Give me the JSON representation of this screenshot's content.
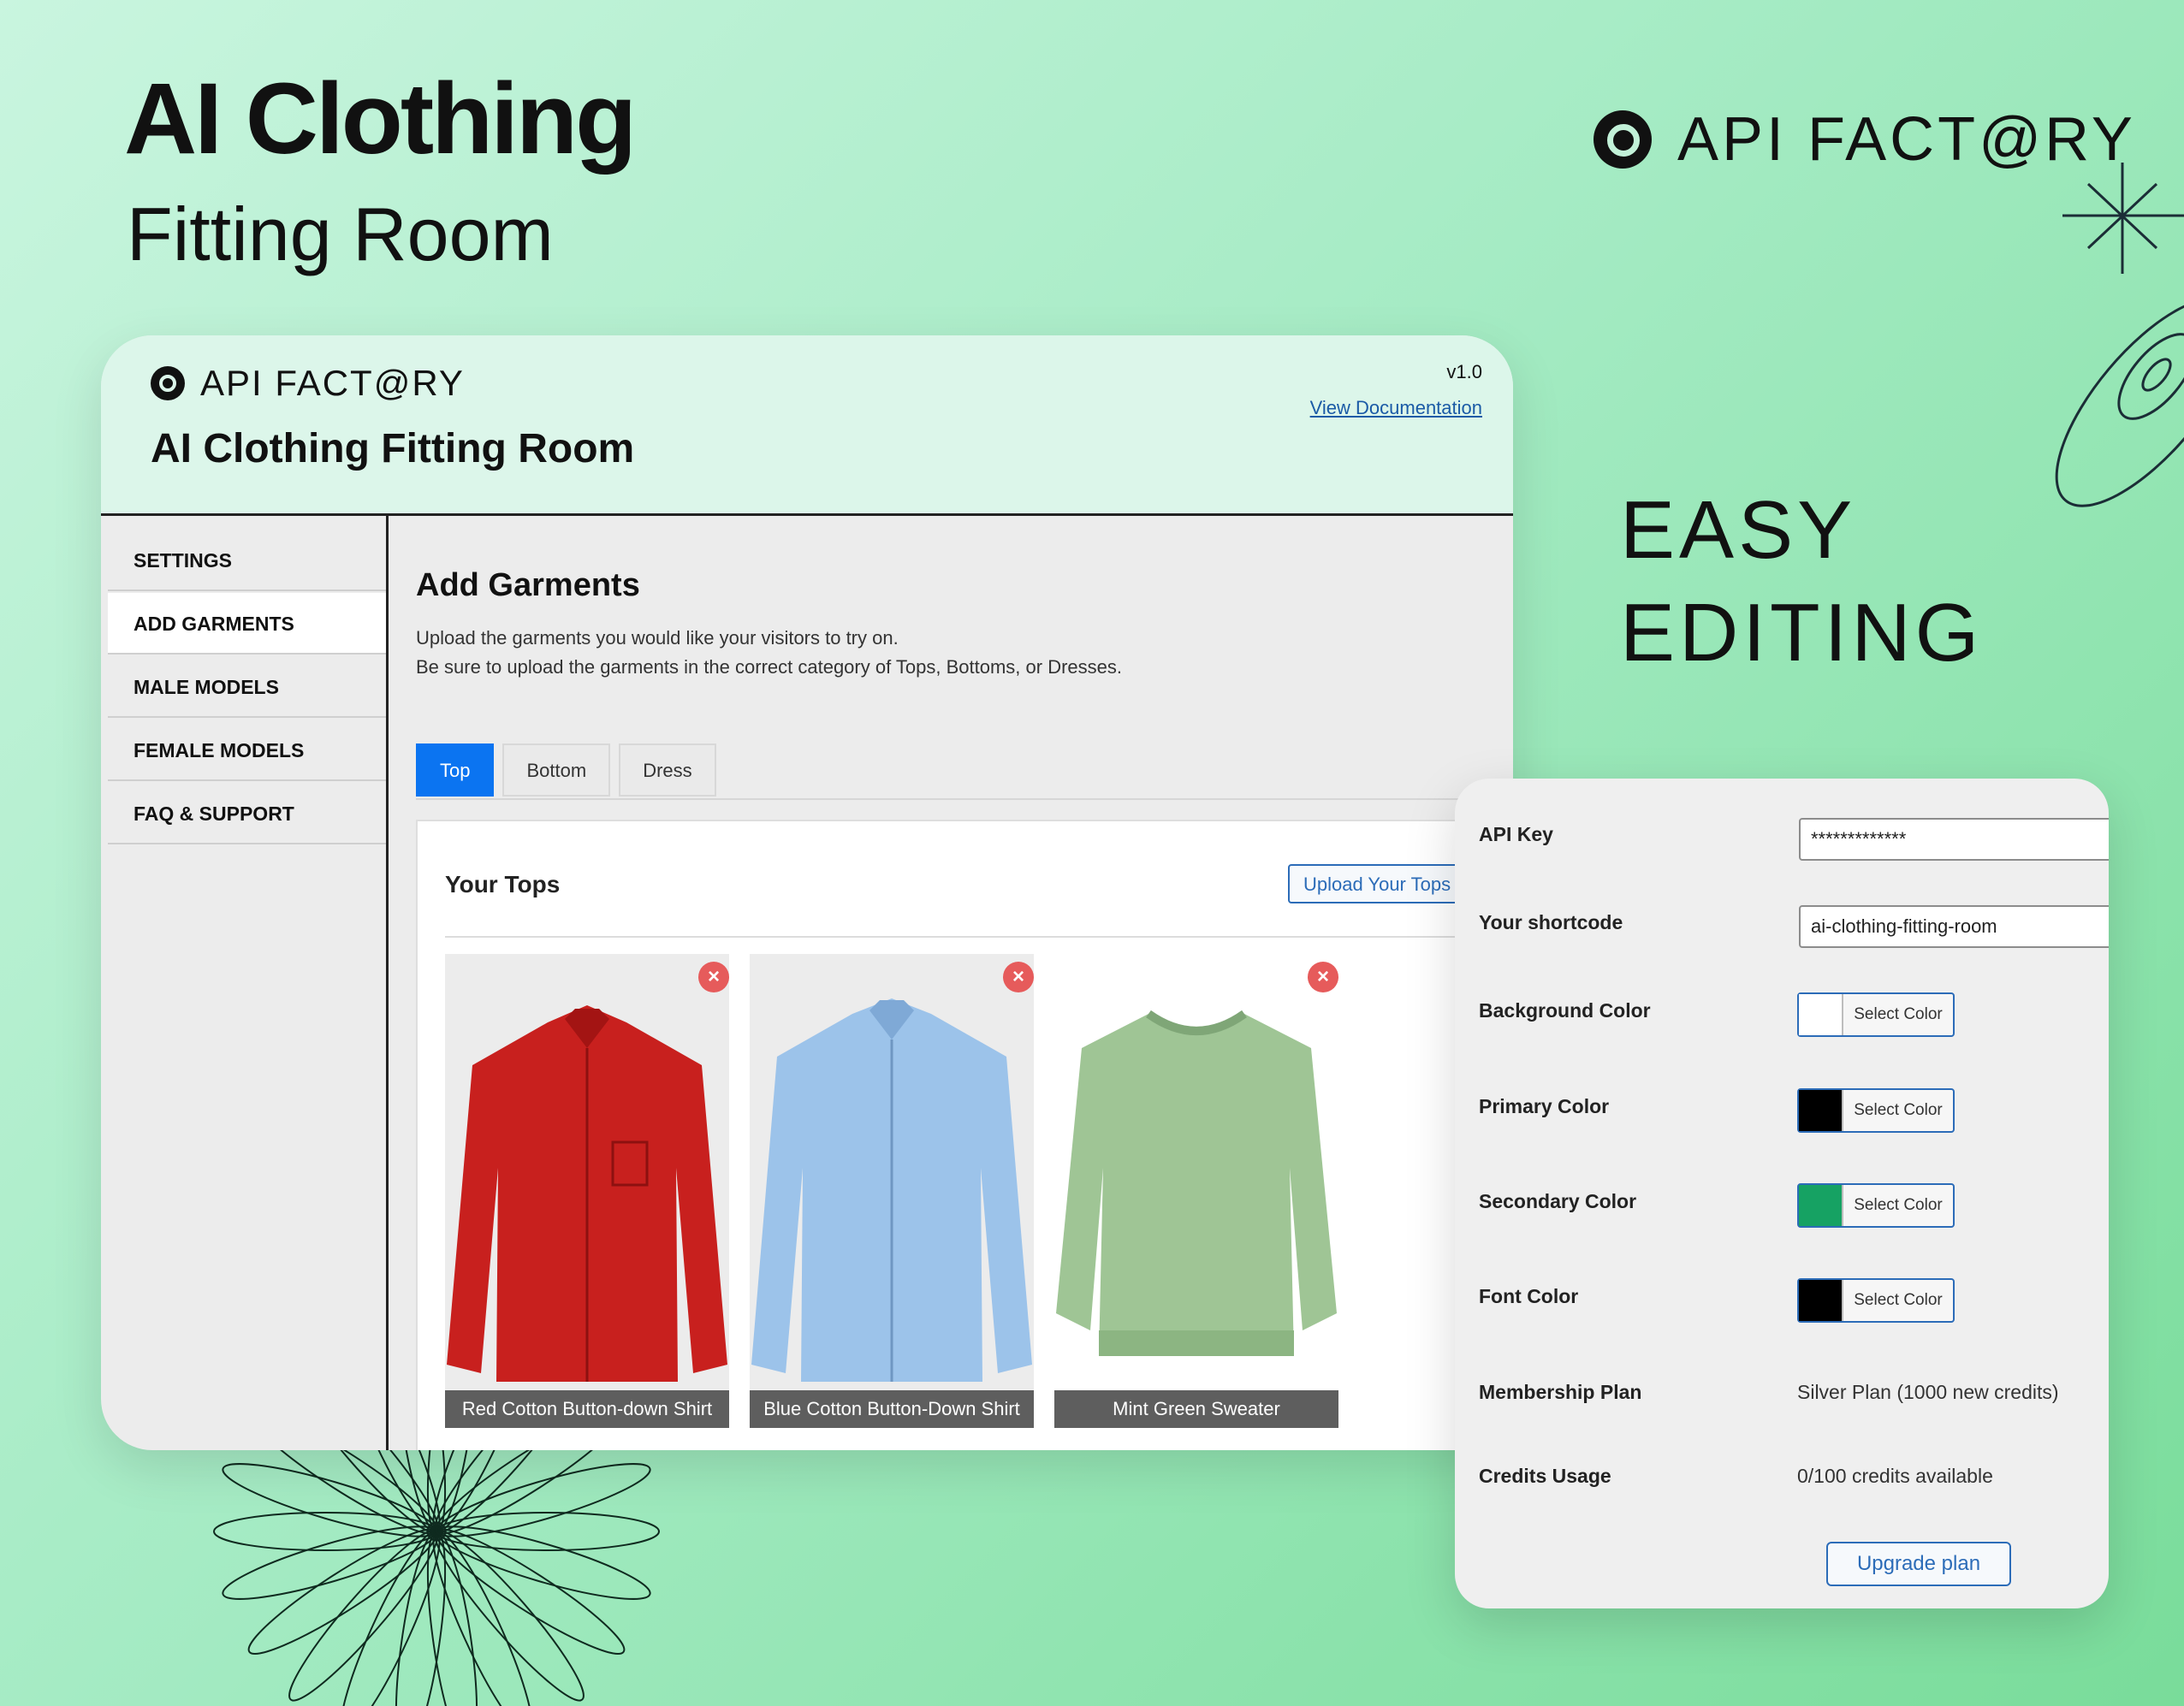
{
  "hero": {
    "title": "AI Clothing",
    "subtitle": "Fitting Room"
  },
  "brand": {
    "name": "API FACT@RY"
  },
  "tagline": {
    "line1": "EASY",
    "line2": "EDITING"
  },
  "app": {
    "logo_text": "API FACT@RY",
    "title": "AI Clothing Fitting Room",
    "version": "v1.0",
    "docs_link": "View Documentation",
    "sidebar": {
      "items": [
        {
          "label": "SETTINGS",
          "active": false
        },
        {
          "label": "ADD GARMENTS",
          "active": true
        },
        {
          "label": "MALE MODELS",
          "active": false
        },
        {
          "label": "FEMALE MODELS",
          "active": false
        },
        {
          "label": "FAQ & SUPPORT",
          "active": false
        }
      ]
    },
    "main": {
      "heading": "Add Garments",
      "desc_line1": "Upload the garments you would like your visitors to try on.",
      "desc_line2": "Be sure to upload the garments in the correct category of Tops, Bottoms, or Dresses.",
      "tabs": [
        {
          "label": "Top",
          "active": true
        },
        {
          "label": "Bottom",
          "active": false
        },
        {
          "label": "Dress",
          "active": false
        }
      ],
      "panel_title": "Your Tops",
      "upload_label": "Upload Your Tops",
      "garments": [
        {
          "name": "Red Cotton Button-down Shirt",
          "color": "#c8201e"
        },
        {
          "name": "Blue Cotton Button-Down Shirt",
          "color": "#9cc3ea"
        },
        {
          "name": "Mint Green Sweater",
          "color": "#9fc595"
        }
      ]
    }
  },
  "settings": {
    "api_key_label": "API Key",
    "api_key_value": "*************",
    "shortcode_label": "Your shortcode",
    "shortcode_value": "ai-clothing-fitting-room",
    "select_color_label": "Select Color",
    "colors": [
      {
        "label": "Background Color",
        "swatch": "#ffffff"
      },
      {
        "label": "Primary Color",
        "swatch": "#000000"
      },
      {
        "label": "Secondary Color",
        "swatch": "#16a263"
      },
      {
        "label": "Font Color",
        "swatch": "#000000"
      }
    ],
    "membership_label": "Membership Plan",
    "membership_value": "Silver Plan (1000 new credits)",
    "credits_label": "Credits Usage",
    "credits_value": "0/100 credits available",
    "upgrade_label": "Upgrade plan"
  },
  "icons": {
    "remove": "close-circle-icon",
    "brand": "at-sign-icon"
  }
}
